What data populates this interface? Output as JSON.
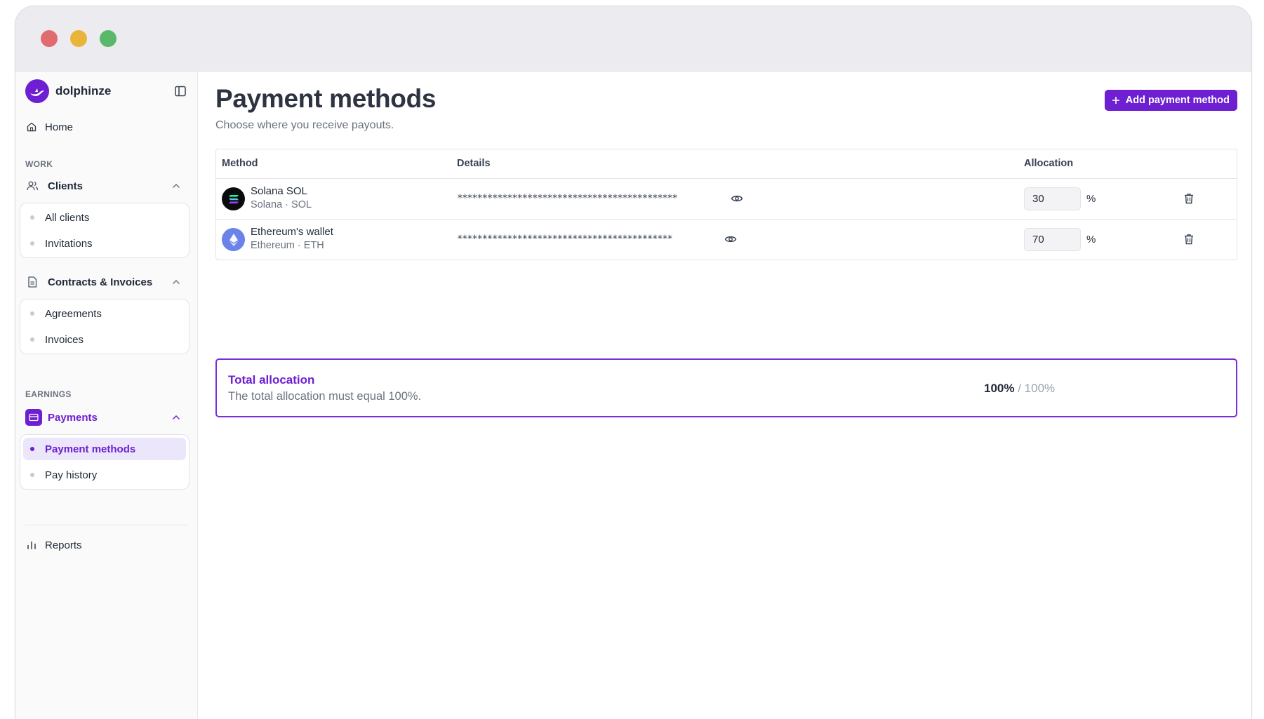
{
  "app": {
    "name": "dolphinze"
  },
  "colors": {
    "accent": "#6d1fd1",
    "accent_soft": "#ece6fb",
    "traffic": [
      "#e26b6f",
      "#e9b43a",
      "#5ab86b"
    ]
  },
  "sidebar": {
    "home": "Home",
    "work_label": "WORK",
    "clients": {
      "label": "Clients",
      "items": [
        "All clients",
        "Invitations"
      ]
    },
    "contracts": {
      "label": "Contracts & Invoices",
      "items": [
        "Agreements",
        "Invoices"
      ]
    },
    "earnings_label": "EARNINGS",
    "payments": {
      "label": "Payments",
      "items": [
        "Payment methods",
        "Pay history"
      ],
      "active_item": "Payment methods"
    },
    "reports": "Reports"
  },
  "page": {
    "title": "Payment methods",
    "subtitle": "Choose where you receive payouts.",
    "add_button": "Add payment method"
  },
  "table": {
    "headers": {
      "method": "Method",
      "details": "Details",
      "allocation": "Allocation"
    },
    "rows": [
      {
        "name": "Solana SOL",
        "sub": "Solana · SOL",
        "masked": "********************************************",
        "allocation": "30",
        "unit": "%",
        "icon": "solana-icon"
      },
      {
        "name": "Ethereum's wallet",
        "sub": "Ethereum · ETH",
        "masked": "*******************************************",
        "allocation": "70",
        "unit": "%",
        "icon": "ethereum-icon"
      }
    ]
  },
  "total": {
    "title": "Total allocation",
    "description": "The total allocation must equal 100%.",
    "current": "100%",
    "separator": " / ",
    "required": "100%"
  }
}
